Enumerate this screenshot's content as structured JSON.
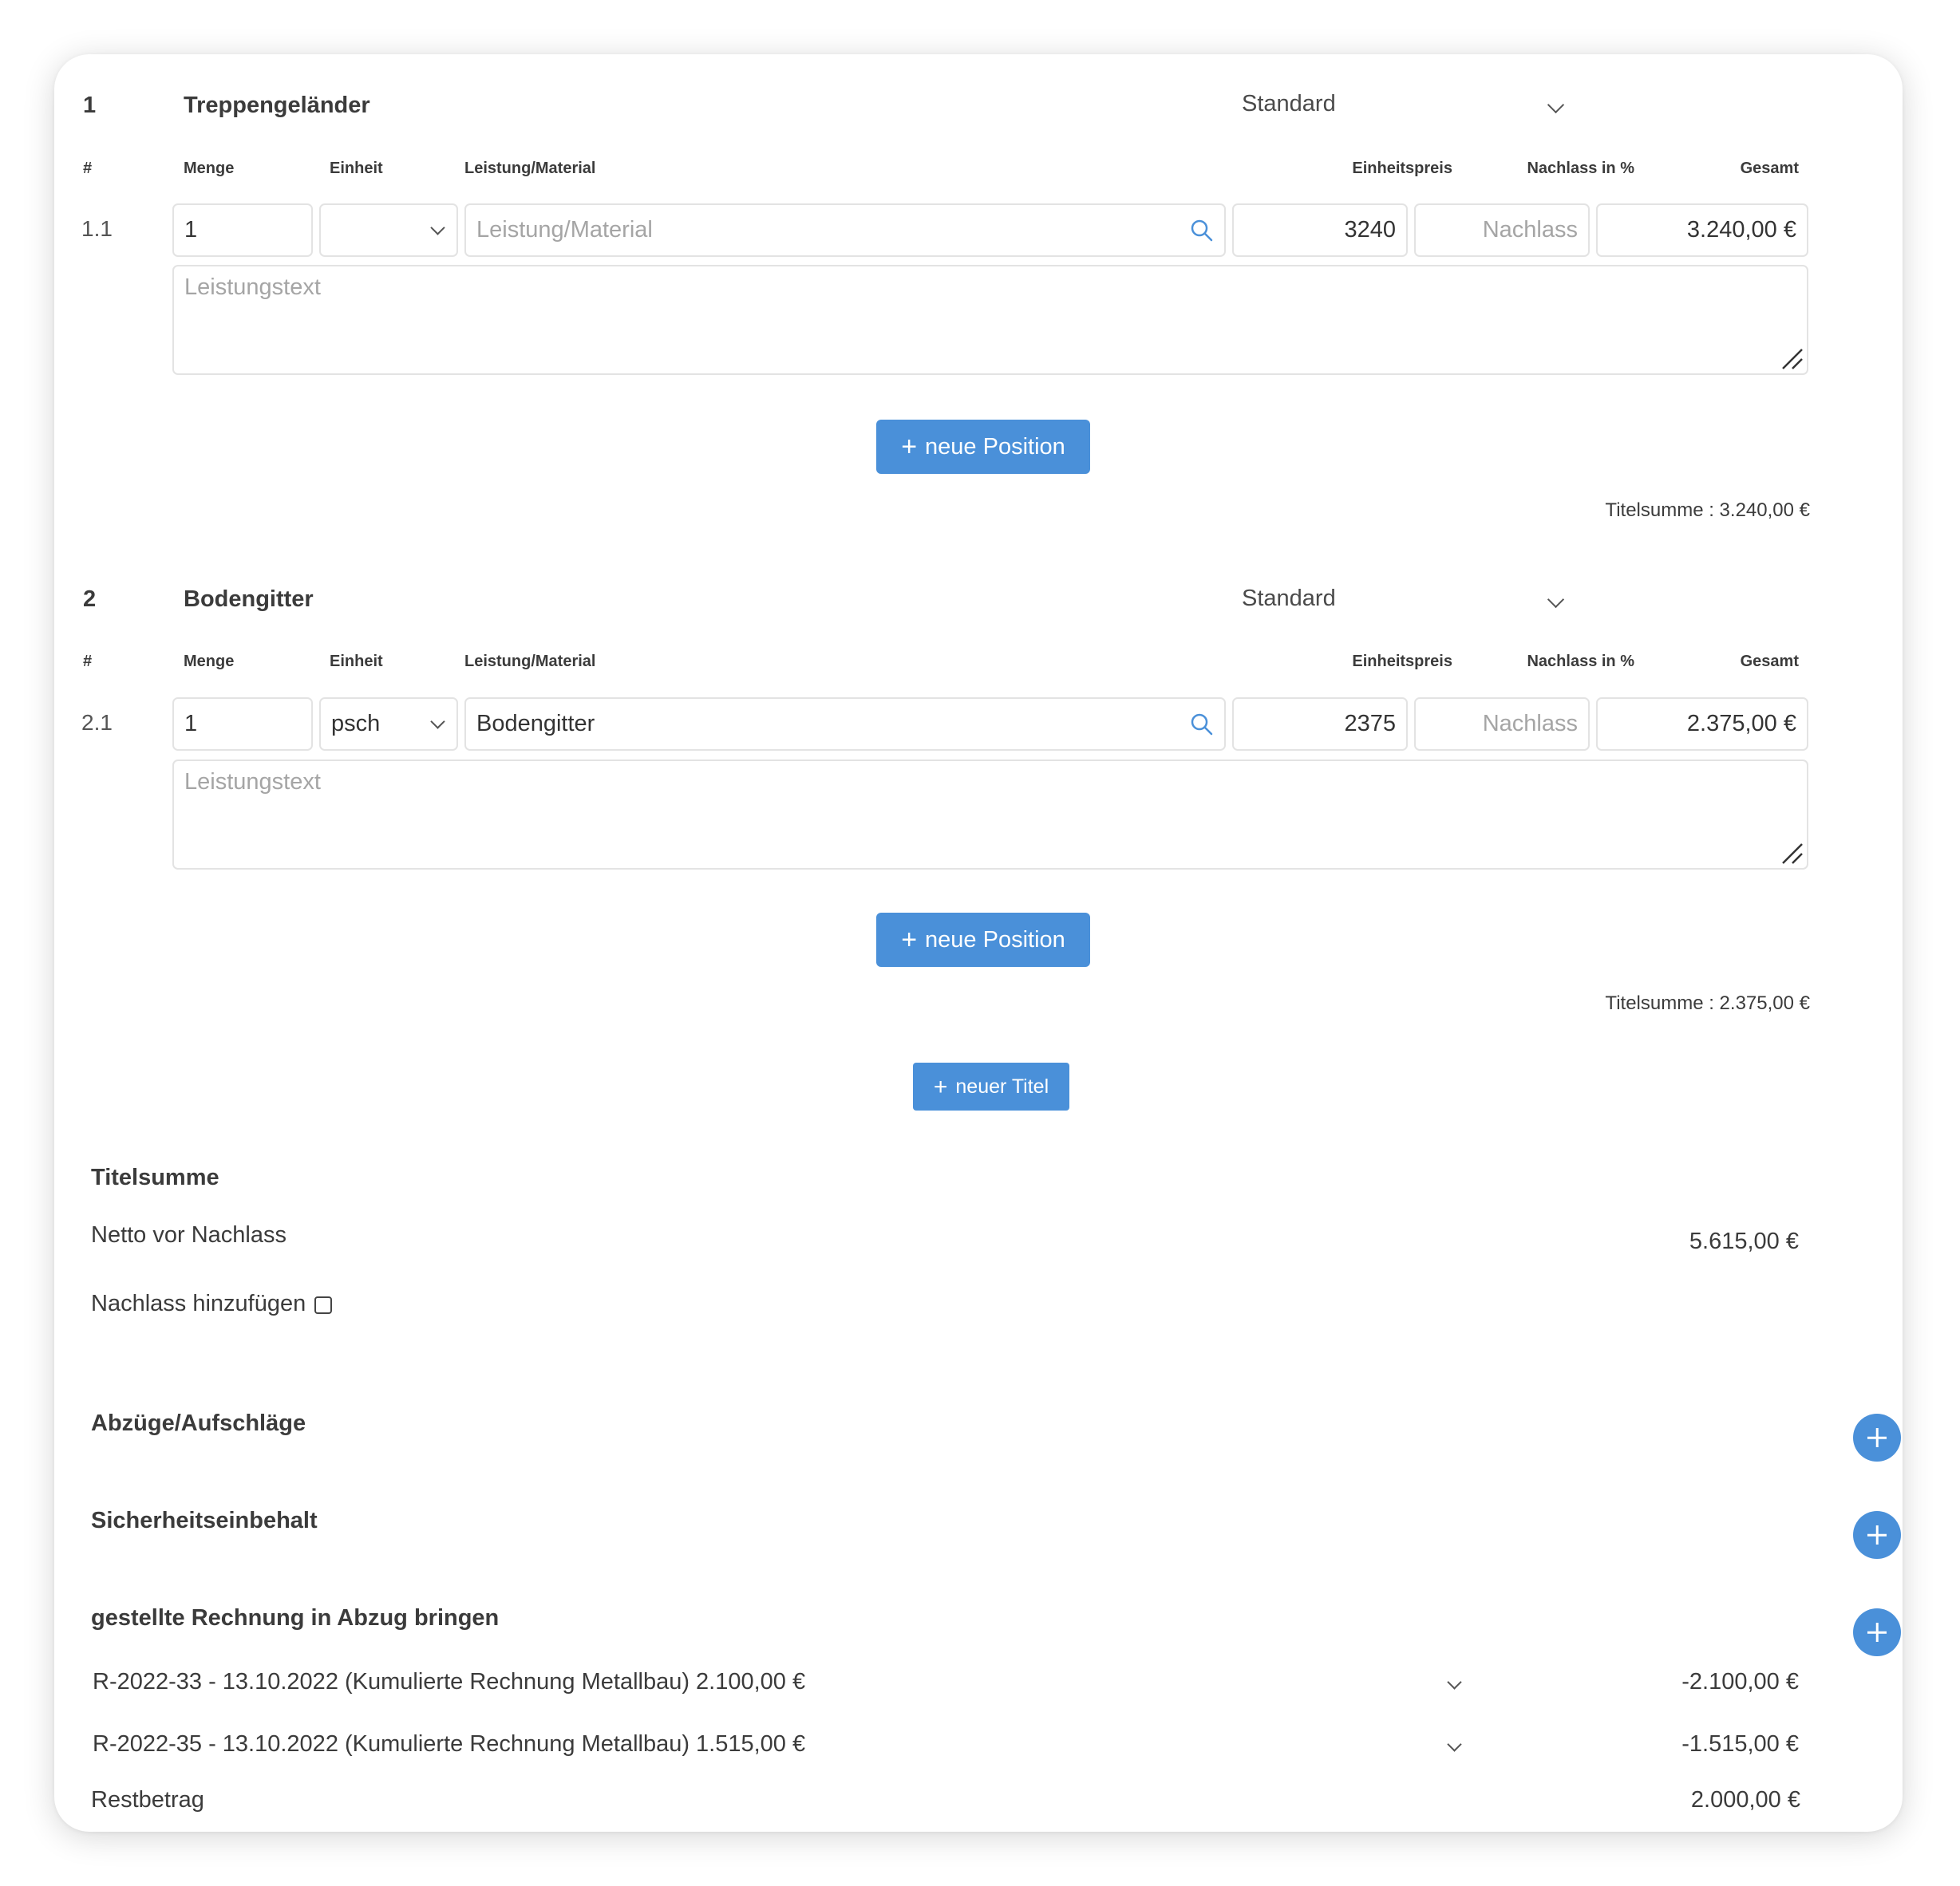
{
  "sections": [
    {
      "number": "1",
      "name": "Treppengeländer",
      "type_select": "Standard",
      "columns": {
        "num": "#",
        "qty": "Menge",
        "unit": "Einheit",
        "service": "Leistung/Material",
        "price": "Einheitspreis",
        "discount": "Nachlass in %",
        "total": "Gesamt"
      },
      "position": {
        "number": "1.1",
        "qty": "1",
        "unit": "",
        "service_value": "",
        "service_placeholder": "Leistung/Material",
        "price": "3240",
        "discount_placeholder": "Nachlass",
        "total": "3.240,00 €",
        "text_placeholder": "Leistungstext"
      },
      "new_position_label": "neue Position",
      "title_sum": "Titelsumme : 3.240,00 €"
    },
    {
      "number": "2",
      "name": "Bodengitter",
      "type_select": "Standard",
      "columns": {
        "num": "#",
        "qty": "Menge",
        "unit": "Einheit",
        "service": "Leistung/Material",
        "price": "Einheitspreis",
        "discount": "Nachlass in %",
        "total": "Gesamt"
      },
      "position": {
        "number": "2.1",
        "qty": "1",
        "unit": "psch",
        "service_value": "Bodengitter",
        "service_placeholder": "Leistung/Material",
        "price": "2375",
        "discount_placeholder": "Nachlass",
        "total": "2.375,00 €",
        "text_placeholder": "Leistungstext"
      },
      "new_position_label": "neue Position",
      "title_sum": "Titelsumme : 2.375,00 €"
    }
  ],
  "new_title_label": "neuer Titel",
  "summary": {
    "heading": "Titelsumme",
    "net_label": "Netto vor Nachlass",
    "net_value": "5.615,00 €",
    "discount_label": "Nachlass hinzufügen",
    "discount_checked": false
  },
  "deductions_heading": "Abzüge/Aufschläge",
  "retention_heading": "Sicherheitseinbehalt",
  "invoices": {
    "heading": "gestellte Rechnung in Abzug bringen",
    "items": [
      {
        "label": "R-2022-33 - 13.10.2022 (Kumulierte Rechnung Metallbau) 2.100,00 €",
        "amount": "-2.100,00 €"
      },
      {
        "label": "R-2022-35 - 13.10.2022 (Kumulierte Rechnung Metallbau) 1.515,00 €",
        "amount": "-1.515,00 €"
      }
    ],
    "rest_label": "Restbetrag",
    "rest_value": "2.000,00 €"
  },
  "colors": {
    "accent": "#4a90d9",
    "border": "#e3e3e3",
    "placeholder": "#a5a5a5"
  },
  "icons": [
    "chevron-down-icon",
    "search-icon",
    "plus-icon",
    "resize-handle-icon"
  ]
}
